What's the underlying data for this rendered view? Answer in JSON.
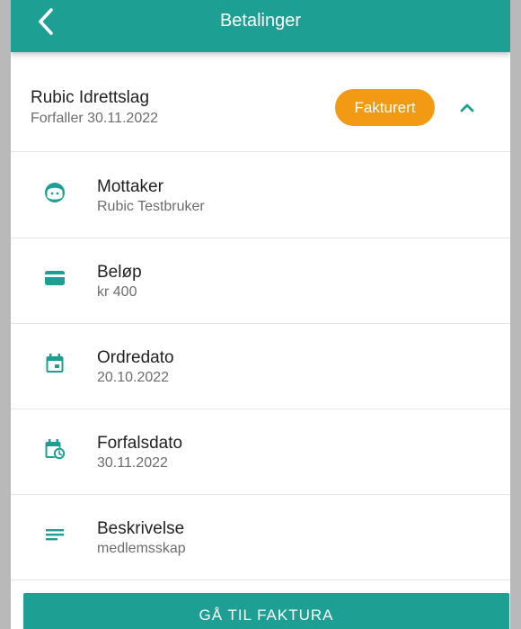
{
  "colors": {
    "brand": "#1e9f93",
    "status": "#f29a13",
    "background": "#ffffff"
  },
  "topbar": {
    "title": "Betalinger",
    "back_icon": "chevron-left-icon"
  },
  "payment": {
    "club": "Rubic Idrettslag",
    "due_line": "Forfaller 30.11.2022",
    "status": "Fakturert",
    "collapse_icon": "chevron-up-icon"
  },
  "details": [
    {
      "icon": "face-icon",
      "title": "Mottaker",
      "value": "Rubic Testbruker"
    },
    {
      "icon": "credit-card-icon",
      "title": "Beløp",
      "value": "kr 400"
    },
    {
      "icon": "calendar-icon",
      "title": "Ordredato",
      "value": "20.10.2022"
    },
    {
      "icon": "calendar-clock-icon",
      "title": "Forfalsdato",
      "value": "30.11.2022"
    },
    {
      "icon": "text-lines-icon",
      "title": "Beskrivelse",
      "value": "medlemsskap"
    }
  ],
  "actions": {
    "primary_label": "GÅ TIL FAKTURA"
  }
}
